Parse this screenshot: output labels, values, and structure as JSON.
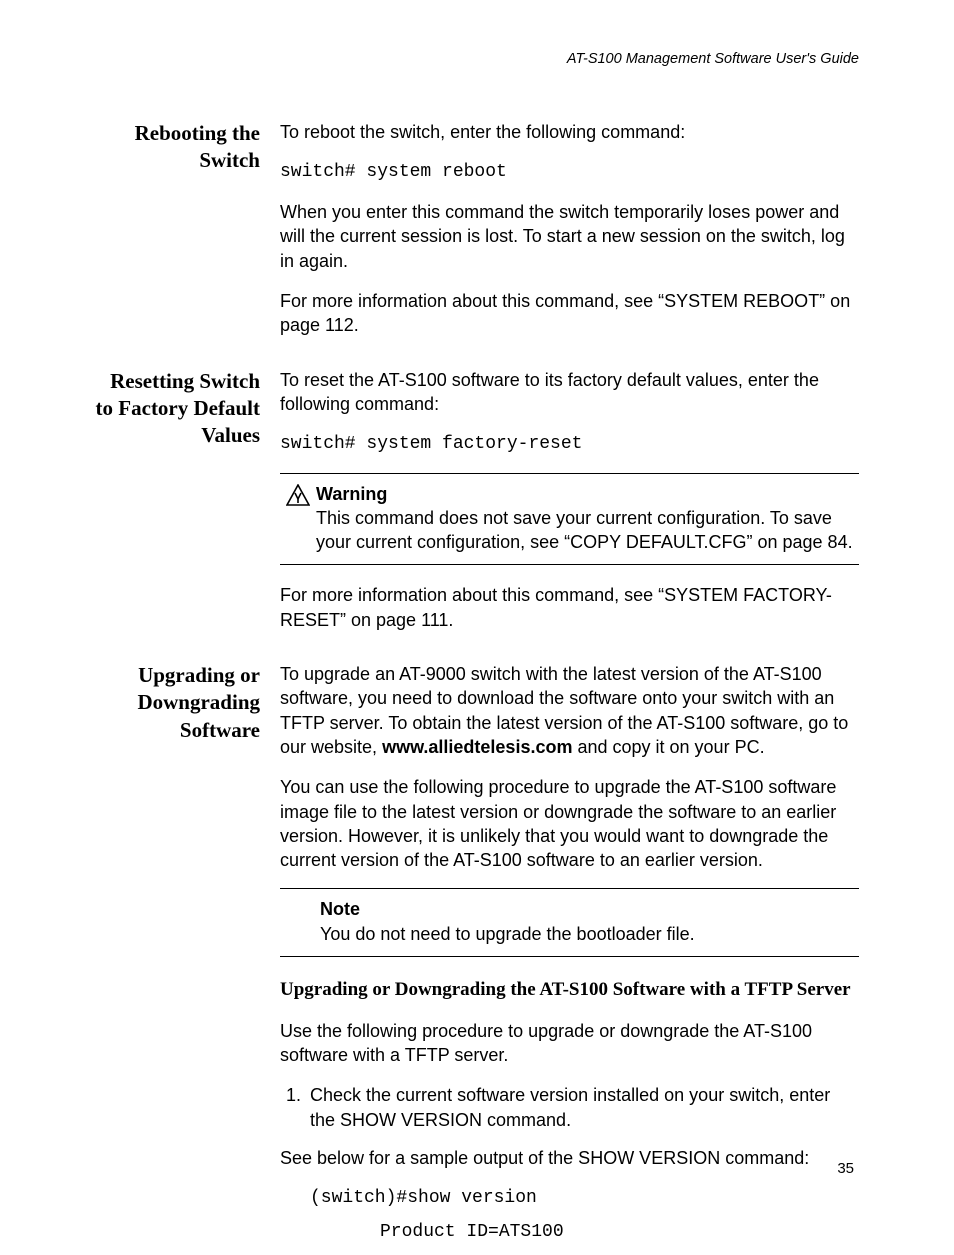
{
  "running_head": "AT-S100 Management Software User's Guide",
  "sections": {
    "reboot": {
      "heading": "Rebooting the Switch",
      "p1": "To reboot the switch, enter the following command:",
      "cmd": "switch# system reboot",
      "p2": "When you enter this command the switch temporarily loses power and will the current session is lost. To start a new session on the switch, log in again.",
      "p3": "For more information about this command, see “SYSTEM REBOOT” on page 112."
    },
    "reset": {
      "heading": "Resetting Switch to Factory Default Values",
      "p1": "To reset the AT-S100 software to its factory default values, enter the following command:",
      "cmd": "switch# system factory-reset",
      "warn_label": "Warning",
      "warn_body": "This command does not save your current configuration. To save your current configuration, see “COPY DEFAULT.CFG” on page 84.",
      "p2": "For more information about this command, see “SYSTEM FACTORY-RESET” on page 111."
    },
    "upgrade": {
      "heading": "Upgrading or Downgrading Software",
      "p1_a": "To upgrade an AT-9000 switch with the latest version of the AT-S100 software, you need to download the software onto your switch with an TFTP server. To obtain the latest version of the AT-S100 software, go to our website, ",
      "p1_bold": "www.alliedtelesis.com",
      "p1_b": " and copy it on your PC.",
      "p2": "You can use the following procedure to upgrade the AT-S100 software image file to the latest version or downgrade the software to an earlier version. However, it is unlikely that you would want to downgrade the current version of the AT-S100 software to an earlier version.",
      "note_label": "Note",
      "note_body": "You do not need to upgrade the bootloader file.",
      "sub_heading": "Upgrading or Downgrading the AT-S100 Software with a TFTP Server",
      "p3": "Use the following procedure to upgrade or downgrade the AT-S100 software with a TFTP server.",
      "step1": "Check the current software version installed on your switch, enter the SHOW VERSION command.",
      "step1_extra": "See below for a sample output of the SHOW VERSION command:",
      "sample1": "(switch)#show version",
      "sample2": "Product ID=ATS100"
    }
  },
  "page_number": "35"
}
